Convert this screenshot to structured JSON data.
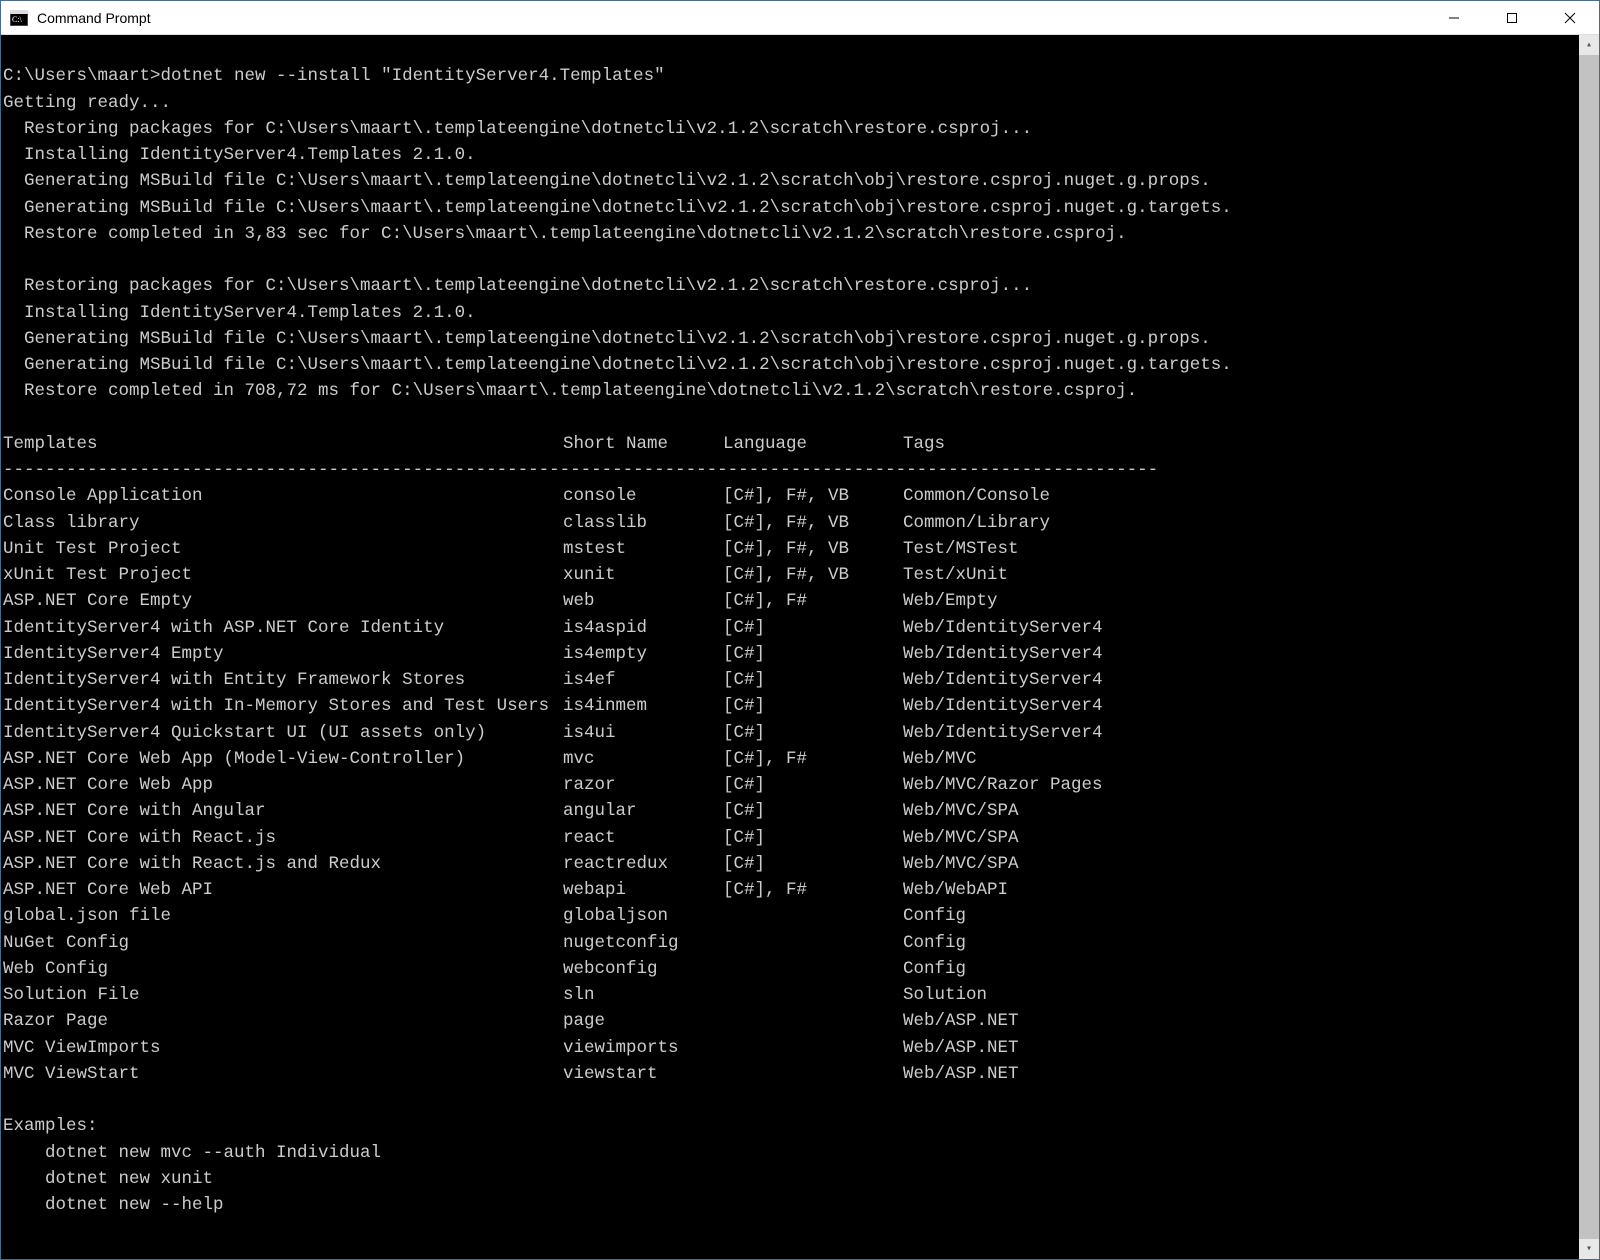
{
  "window": {
    "title": "Command Prompt"
  },
  "prompt": {
    "path": "C:\\Users\\maart>",
    "command": "dotnet new --install \"IdentityServer4.Templates\""
  },
  "output_lines_pre": [
    "Getting ready...",
    "  Restoring packages for C:\\Users\\maart\\.templateengine\\dotnetcli\\v2.1.2\\scratch\\restore.csproj...",
    "  Installing IdentityServer4.Templates 2.1.0.",
    "  Generating MSBuild file C:\\Users\\maart\\.templateengine\\dotnetcli\\v2.1.2\\scratch\\obj\\restore.csproj.nuget.g.props.",
    "  Generating MSBuild file C:\\Users\\maart\\.templateengine\\dotnetcli\\v2.1.2\\scratch\\obj\\restore.csproj.nuget.g.targets.",
    "  Restore completed in 3,83 sec for C:\\Users\\maart\\.templateengine\\dotnetcli\\v2.1.2\\scratch\\restore.csproj.",
    "",
    "  Restoring packages for C:\\Users\\maart\\.templateengine\\dotnetcli\\v2.1.2\\scratch\\restore.csproj...",
    "  Installing IdentityServer4.Templates 2.1.0.",
    "  Generating MSBuild file C:\\Users\\maart\\.templateengine\\dotnetcli\\v2.1.2\\scratch\\obj\\restore.csproj.nuget.g.props.",
    "  Generating MSBuild file C:\\Users\\maart\\.templateengine\\dotnetcli\\v2.1.2\\scratch\\obj\\restore.csproj.nuget.g.targets.",
    "  Restore completed in 708,72 ms for C:\\Users\\maart\\.templateengine\\dotnetcli\\v2.1.2\\scratch\\restore.csproj.",
    ""
  ],
  "table_headers": {
    "templates": "Templates",
    "short": "Short Name",
    "language": "Language",
    "tags": "Tags"
  },
  "dash_line": "--------------------------------------------------------------------------------------------------------------",
  "templates": [
    {
      "name": "Console Application",
      "short": "console",
      "lang": "[C#], F#, VB",
      "tags": "Common/Console"
    },
    {
      "name": "Class library",
      "short": "classlib",
      "lang": "[C#], F#, VB",
      "tags": "Common/Library"
    },
    {
      "name": "Unit Test Project",
      "short": "mstest",
      "lang": "[C#], F#, VB",
      "tags": "Test/MSTest"
    },
    {
      "name": "xUnit Test Project",
      "short": "xunit",
      "lang": "[C#], F#, VB",
      "tags": "Test/xUnit"
    },
    {
      "name": "ASP.NET Core Empty",
      "short": "web",
      "lang": "[C#], F#",
      "tags": "Web/Empty"
    },
    {
      "name": "IdentityServer4 with ASP.NET Core Identity",
      "short": "is4aspid",
      "lang": "[C#]",
      "tags": "Web/IdentityServer4"
    },
    {
      "name": "IdentityServer4 Empty",
      "short": "is4empty",
      "lang": "[C#]",
      "tags": "Web/IdentityServer4"
    },
    {
      "name": "IdentityServer4 with Entity Framework Stores",
      "short": "is4ef",
      "lang": "[C#]",
      "tags": "Web/IdentityServer4"
    },
    {
      "name": "IdentityServer4 with In-Memory Stores and Test Users",
      "short": "is4inmem",
      "lang": "[C#]",
      "tags": "Web/IdentityServer4"
    },
    {
      "name": "IdentityServer4 Quickstart UI (UI assets only)",
      "short": "is4ui",
      "lang": "[C#]",
      "tags": "Web/IdentityServer4"
    },
    {
      "name": "ASP.NET Core Web App (Model-View-Controller)",
      "short": "mvc",
      "lang": "[C#], F#",
      "tags": "Web/MVC"
    },
    {
      "name": "ASP.NET Core Web App",
      "short": "razor",
      "lang": "[C#]",
      "tags": "Web/MVC/Razor Pages"
    },
    {
      "name": "ASP.NET Core with Angular",
      "short": "angular",
      "lang": "[C#]",
      "tags": "Web/MVC/SPA"
    },
    {
      "name": "ASP.NET Core with React.js",
      "short": "react",
      "lang": "[C#]",
      "tags": "Web/MVC/SPA"
    },
    {
      "name": "ASP.NET Core with React.js and Redux",
      "short": "reactredux",
      "lang": "[C#]",
      "tags": "Web/MVC/SPA"
    },
    {
      "name": "ASP.NET Core Web API",
      "short": "webapi",
      "lang": "[C#], F#",
      "tags": "Web/WebAPI"
    },
    {
      "name": "global.json file",
      "short": "globaljson",
      "lang": "",
      "tags": "Config"
    },
    {
      "name": "NuGet Config",
      "short": "nugetconfig",
      "lang": "",
      "tags": "Config"
    },
    {
      "name": "Web Config",
      "short": "webconfig",
      "lang": "",
      "tags": "Config"
    },
    {
      "name": "Solution File",
      "short": "sln",
      "lang": "",
      "tags": "Solution"
    },
    {
      "name": "Razor Page",
      "short": "page",
      "lang": "",
      "tags": "Web/ASP.NET"
    },
    {
      "name": "MVC ViewImports",
      "short": "viewimports",
      "lang": "",
      "tags": "Web/ASP.NET"
    },
    {
      "name": "MVC ViewStart",
      "short": "viewstart",
      "lang": "",
      "tags": "Web/ASP.NET"
    }
  ],
  "examples_header": "Examples:",
  "examples": [
    "    dotnet new mvc --auth Individual",
    "    dotnet new xunit",
    "    dotnet new --help"
  ]
}
